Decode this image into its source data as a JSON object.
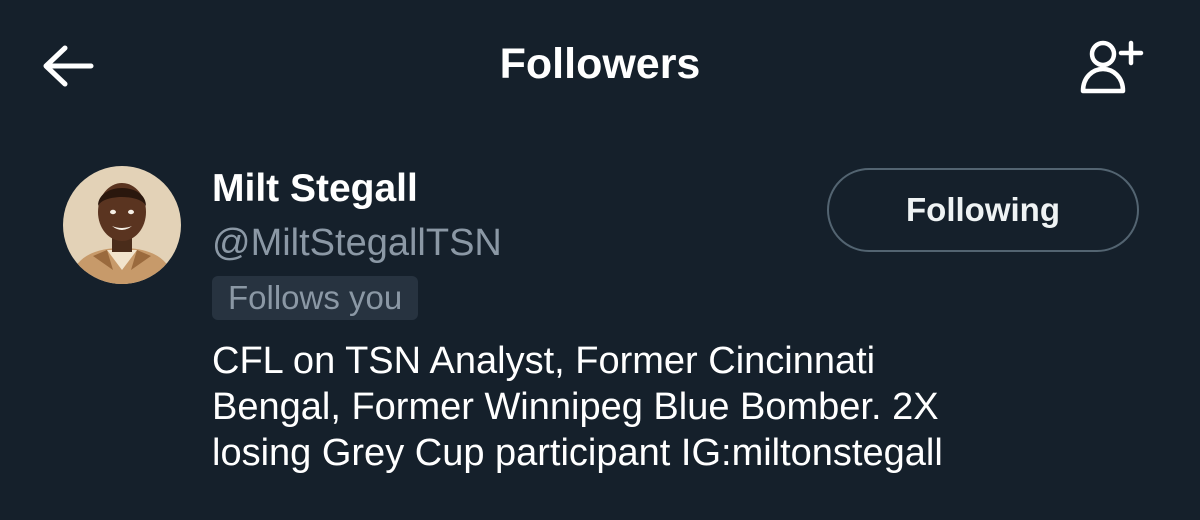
{
  "header": {
    "title": "Followers",
    "back_icon": "arrow-left-icon",
    "add_icon": "add-user-icon"
  },
  "user": {
    "display_name": "Milt Stegall",
    "handle": "@MiltStegallTSN",
    "follows_you_badge": "Follows you",
    "follow_button_label": "Following",
    "bio_lines": [
      "CFL on TSN Analyst, Former Cincinnati",
      "Bengal, Former Winnipeg Blue Bomber. 2X",
      "losing Grey Cup participant IG:miltonstegall"
    ]
  },
  "colors": {
    "background": "#15202b",
    "primary_text": "#ffffff",
    "secondary_text": "#8b98a5",
    "badge_background": "#273340",
    "button_border": "#536471"
  }
}
